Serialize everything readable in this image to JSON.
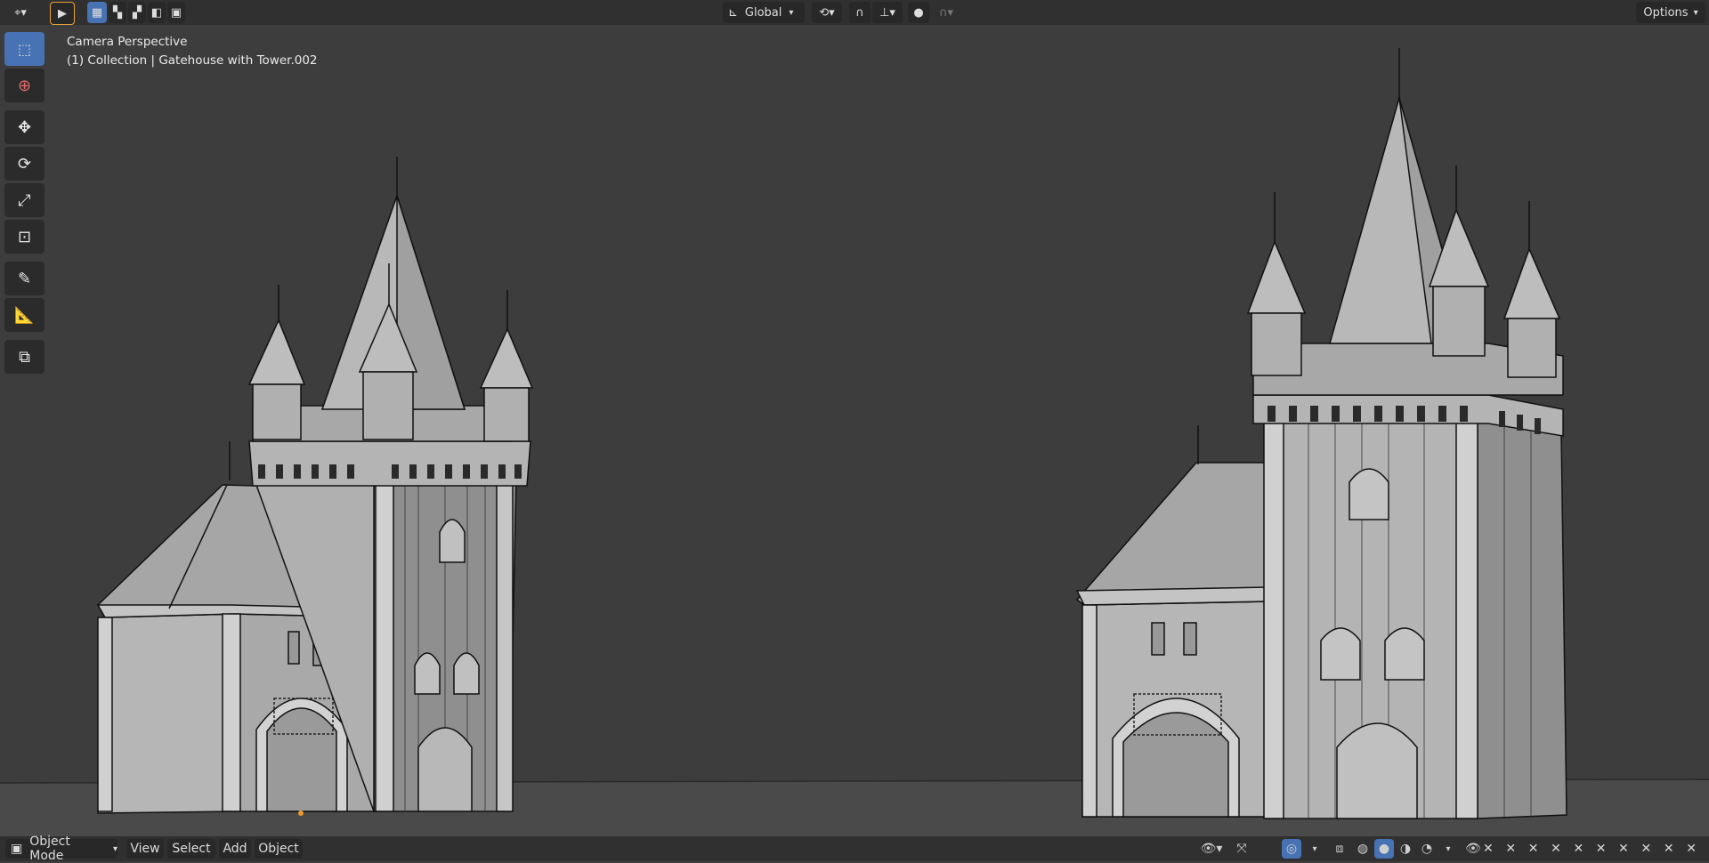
{
  "header": {
    "transform_orientation": "Global",
    "options_label": "Options"
  },
  "viewport": {
    "view_name": "Camera Perspective",
    "object_info": "(1) Collection | Gatehouse with Tower.002"
  },
  "footer": {
    "mode_label": "Object Mode",
    "menu": [
      "View",
      "Select",
      "Add",
      "Object"
    ]
  },
  "colors": {
    "accent": "#4772b3",
    "viewport_bg": "#3d3d3d",
    "header_bg": "#303030",
    "model_light": "#b9b9b9",
    "model_dark": "#8a8a8a"
  },
  "icons": [
    "editor-type-icon",
    "select-tool-icon",
    "select-mode-icons",
    "orientation-icon",
    "pivot-icon",
    "snap-icon",
    "proportional-edit-icon",
    "cursor-tool-icon",
    "move-tool-icon",
    "rotate-tool-icon",
    "scale-tool-icon",
    "transform-tool-icon",
    "annotate-tool-icon",
    "measure-tool-icon",
    "add-cube-tool-icon",
    "visibility-icon",
    "gizmo-icon",
    "overlay-icon",
    "xray-icon",
    "shading-icons"
  ]
}
